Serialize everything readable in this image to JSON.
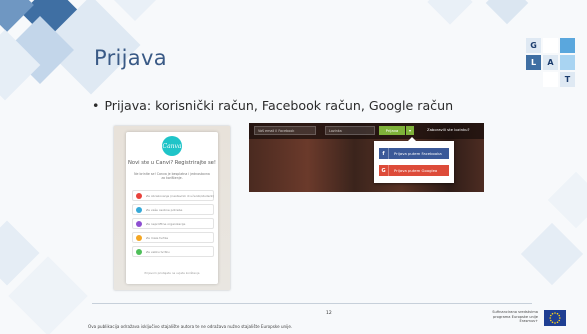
{
  "slide": {
    "title": "Prijava",
    "bullet": "Prijava: korisnički račun, Facebook račun, Google račun",
    "page_number": "12",
    "disclaimer": "Ova publikacija odražava isključivo stajalište autora te ne odražava nužno stajalište Europske unije.",
    "eu_funding_lines": [
      "Sufinancirano sredstvima",
      "programa Europske unije",
      "Erasmus+"
    ]
  },
  "logo": {
    "letters": [
      "G",
      "L",
      "A",
      "T"
    ],
    "colors": {
      "dark": "#1c3d6e",
      "light": "#a9d4f2",
      "mid": "#5aa7dd"
    }
  },
  "canva": {
    "logo_text": "Canva",
    "heading": "Novi ste u Canvi? Registrirajte se!",
    "sub": "Ne brinite se! Canva je besplatna i jednostavna za korištenje.",
    "options": [
      {
        "text": "Za obrazovanje (nastavnik ili učenik/student)",
        "color": "#e8423b"
      },
      {
        "text": "Za vaše osobne potrebe",
        "color": "#36a9d8"
      },
      {
        "text": "Za neprofitne organizacije",
        "color": "#8e4fd1"
      },
      {
        "text": "Za male tvrtke",
        "color": "#f4a623"
      },
      {
        "text": "Za veliku tvrtku",
        "color": "#4fbf5a"
      }
    ],
    "footer": "Prijavom pristajete na uvjete korištenja"
  },
  "fb_panel": {
    "email_placeholder": "Vaš email il Facebook",
    "password_placeholder": "Lozinka",
    "login_button": "Prijava",
    "forgot_link": "Zaboravili ste lozinku?",
    "facebook_button": "Prijava putem Facebooka",
    "google_button": "Prijava putem Googlea",
    "colors": {
      "facebook": "#3b5998",
      "google": "#dd4b39",
      "login": "#7fb23a"
    }
  },
  "colors": {
    "title": "#3a5a86",
    "deco_dark": "#3f6fa3",
    "deco_light": "#cfe0ef"
  }
}
